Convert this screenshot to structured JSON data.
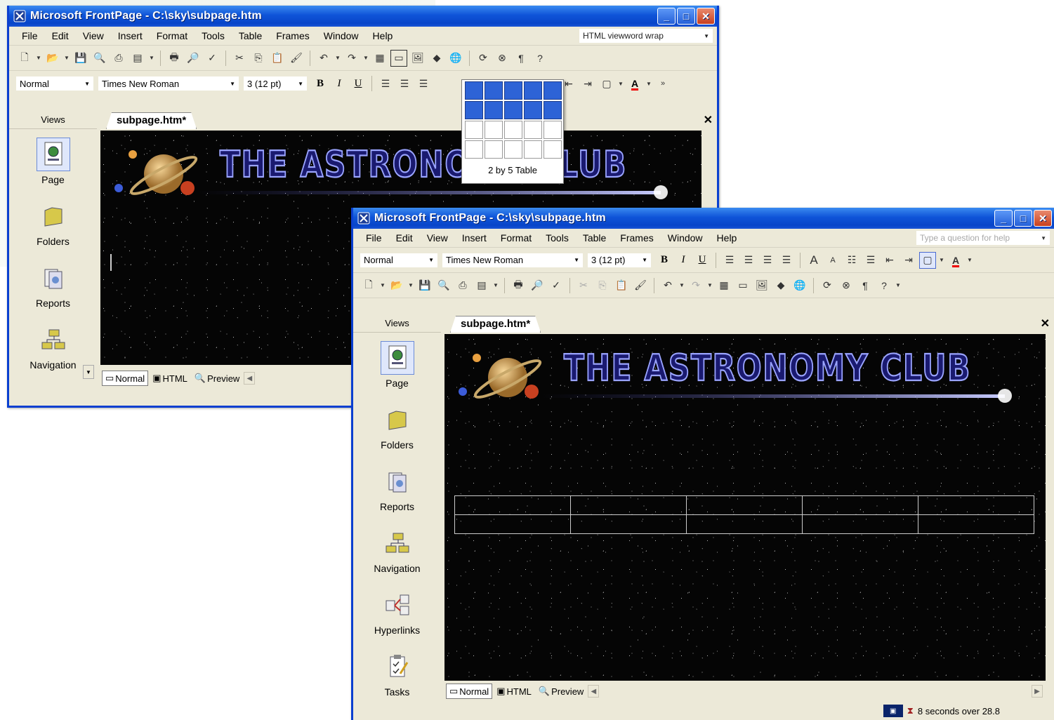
{
  "window1": {
    "title": "Microsoft FrontPage - C:\\sky\\subpage.htm",
    "menu": [
      "File",
      "Edit",
      "View",
      "Insert",
      "Format",
      "Tools",
      "Table",
      "Frames",
      "Window",
      "Help"
    ],
    "help_box": "HTML viewword wrap",
    "style_combo": "Normal",
    "font_combo": "Times New Roman",
    "size_combo": "3  (12 pt)",
    "views_header": "Views",
    "views": [
      "Page",
      "Folders",
      "Reports",
      "Navigation"
    ],
    "doc_tab": "subpage.htm*",
    "bottom_tabs": [
      "Normal",
      "HTML",
      "Preview"
    ],
    "banner_title": "THE ASTRONOMY CLUB",
    "table_picker": {
      "rows_selected": 2,
      "cols_selected": 5,
      "grid_rows": 4,
      "grid_cols": 5,
      "label": "2 by 5 Table"
    }
  },
  "window2": {
    "title": "Microsoft FrontPage - C:\\sky\\subpage.htm",
    "menu": [
      "File",
      "Edit",
      "View",
      "Insert",
      "Format",
      "Tools",
      "Table",
      "Frames",
      "Window",
      "Help"
    ],
    "help_box": "Type a question for help",
    "style_combo": "Normal",
    "font_combo": "Times New Roman",
    "size_combo": "3  (12 pt)",
    "views_header": "Views",
    "views": [
      "Page",
      "Folders",
      "Reports",
      "Navigation",
      "Hyperlinks",
      "Tasks"
    ],
    "doc_tab": "subpage.htm*",
    "bottom_tabs": [
      "Normal",
      "HTML",
      "Preview"
    ],
    "banner_title": "THE ASTRONOMY CLUB",
    "table": {
      "rows": 2,
      "cols": 5
    },
    "status_text": "8 seconds over 28.8"
  }
}
